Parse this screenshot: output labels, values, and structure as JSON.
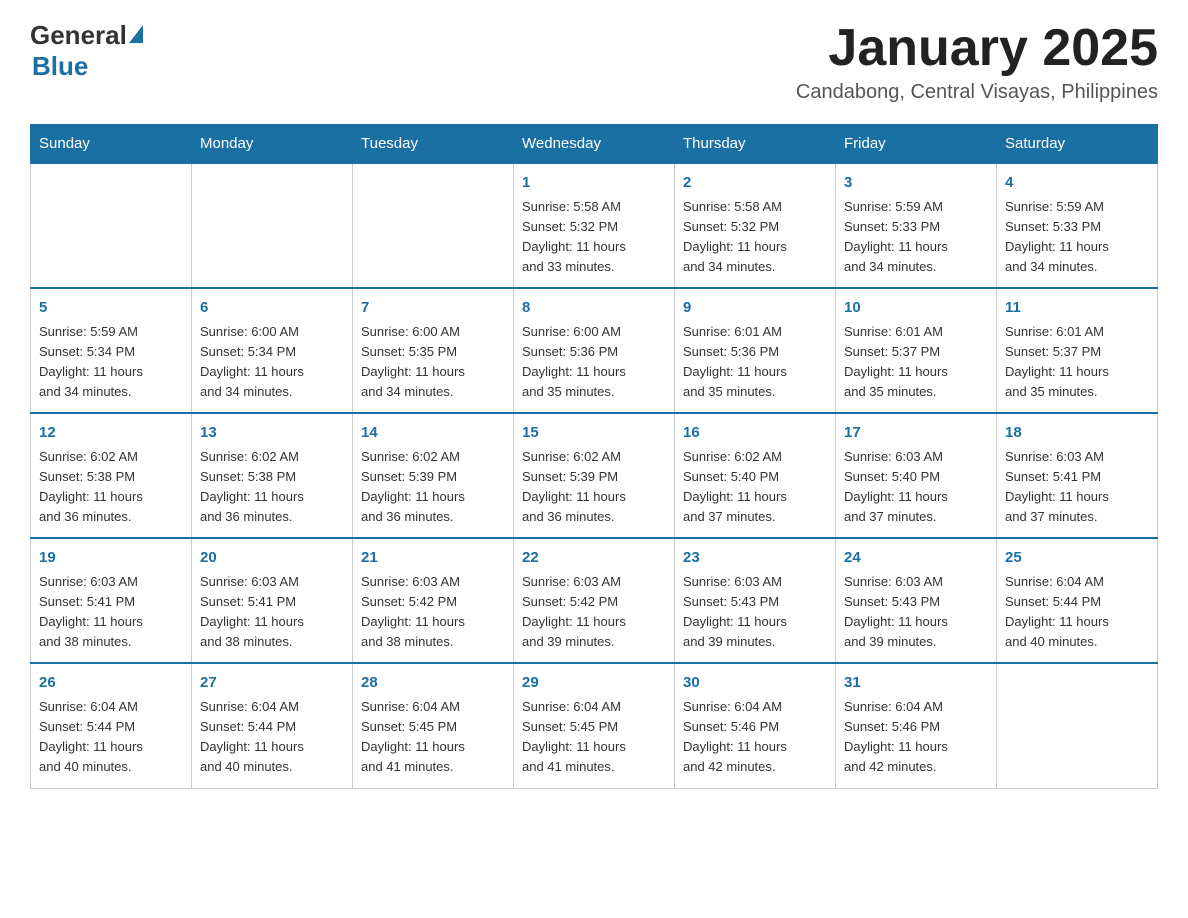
{
  "header": {
    "logo_general": "General",
    "logo_blue": "Blue",
    "month_title": "January 2025",
    "location": "Candabong, Central Visayas, Philippines"
  },
  "days_of_week": [
    "Sunday",
    "Monday",
    "Tuesday",
    "Wednesday",
    "Thursday",
    "Friday",
    "Saturday"
  ],
  "weeks": [
    [
      {
        "day": "",
        "info": ""
      },
      {
        "day": "",
        "info": ""
      },
      {
        "day": "",
        "info": ""
      },
      {
        "day": "1",
        "info": "Sunrise: 5:58 AM\nSunset: 5:32 PM\nDaylight: 11 hours\nand 33 minutes."
      },
      {
        "day": "2",
        "info": "Sunrise: 5:58 AM\nSunset: 5:32 PM\nDaylight: 11 hours\nand 34 minutes."
      },
      {
        "day": "3",
        "info": "Sunrise: 5:59 AM\nSunset: 5:33 PM\nDaylight: 11 hours\nand 34 minutes."
      },
      {
        "day": "4",
        "info": "Sunrise: 5:59 AM\nSunset: 5:33 PM\nDaylight: 11 hours\nand 34 minutes."
      }
    ],
    [
      {
        "day": "5",
        "info": "Sunrise: 5:59 AM\nSunset: 5:34 PM\nDaylight: 11 hours\nand 34 minutes."
      },
      {
        "day": "6",
        "info": "Sunrise: 6:00 AM\nSunset: 5:34 PM\nDaylight: 11 hours\nand 34 minutes."
      },
      {
        "day": "7",
        "info": "Sunrise: 6:00 AM\nSunset: 5:35 PM\nDaylight: 11 hours\nand 34 minutes."
      },
      {
        "day": "8",
        "info": "Sunrise: 6:00 AM\nSunset: 5:36 PM\nDaylight: 11 hours\nand 35 minutes."
      },
      {
        "day": "9",
        "info": "Sunrise: 6:01 AM\nSunset: 5:36 PM\nDaylight: 11 hours\nand 35 minutes."
      },
      {
        "day": "10",
        "info": "Sunrise: 6:01 AM\nSunset: 5:37 PM\nDaylight: 11 hours\nand 35 minutes."
      },
      {
        "day": "11",
        "info": "Sunrise: 6:01 AM\nSunset: 5:37 PM\nDaylight: 11 hours\nand 35 minutes."
      }
    ],
    [
      {
        "day": "12",
        "info": "Sunrise: 6:02 AM\nSunset: 5:38 PM\nDaylight: 11 hours\nand 36 minutes."
      },
      {
        "day": "13",
        "info": "Sunrise: 6:02 AM\nSunset: 5:38 PM\nDaylight: 11 hours\nand 36 minutes."
      },
      {
        "day": "14",
        "info": "Sunrise: 6:02 AM\nSunset: 5:39 PM\nDaylight: 11 hours\nand 36 minutes."
      },
      {
        "day": "15",
        "info": "Sunrise: 6:02 AM\nSunset: 5:39 PM\nDaylight: 11 hours\nand 36 minutes."
      },
      {
        "day": "16",
        "info": "Sunrise: 6:02 AM\nSunset: 5:40 PM\nDaylight: 11 hours\nand 37 minutes."
      },
      {
        "day": "17",
        "info": "Sunrise: 6:03 AM\nSunset: 5:40 PM\nDaylight: 11 hours\nand 37 minutes."
      },
      {
        "day": "18",
        "info": "Sunrise: 6:03 AM\nSunset: 5:41 PM\nDaylight: 11 hours\nand 37 minutes."
      }
    ],
    [
      {
        "day": "19",
        "info": "Sunrise: 6:03 AM\nSunset: 5:41 PM\nDaylight: 11 hours\nand 38 minutes."
      },
      {
        "day": "20",
        "info": "Sunrise: 6:03 AM\nSunset: 5:41 PM\nDaylight: 11 hours\nand 38 minutes."
      },
      {
        "day": "21",
        "info": "Sunrise: 6:03 AM\nSunset: 5:42 PM\nDaylight: 11 hours\nand 38 minutes."
      },
      {
        "day": "22",
        "info": "Sunrise: 6:03 AM\nSunset: 5:42 PM\nDaylight: 11 hours\nand 39 minutes."
      },
      {
        "day": "23",
        "info": "Sunrise: 6:03 AM\nSunset: 5:43 PM\nDaylight: 11 hours\nand 39 minutes."
      },
      {
        "day": "24",
        "info": "Sunrise: 6:03 AM\nSunset: 5:43 PM\nDaylight: 11 hours\nand 39 minutes."
      },
      {
        "day": "25",
        "info": "Sunrise: 6:04 AM\nSunset: 5:44 PM\nDaylight: 11 hours\nand 40 minutes."
      }
    ],
    [
      {
        "day": "26",
        "info": "Sunrise: 6:04 AM\nSunset: 5:44 PM\nDaylight: 11 hours\nand 40 minutes."
      },
      {
        "day": "27",
        "info": "Sunrise: 6:04 AM\nSunset: 5:44 PM\nDaylight: 11 hours\nand 40 minutes."
      },
      {
        "day": "28",
        "info": "Sunrise: 6:04 AM\nSunset: 5:45 PM\nDaylight: 11 hours\nand 41 minutes."
      },
      {
        "day": "29",
        "info": "Sunrise: 6:04 AM\nSunset: 5:45 PM\nDaylight: 11 hours\nand 41 minutes."
      },
      {
        "day": "30",
        "info": "Sunrise: 6:04 AM\nSunset: 5:46 PM\nDaylight: 11 hours\nand 42 minutes."
      },
      {
        "day": "31",
        "info": "Sunrise: 6:04 AM\nSunset: 5:46 PM\nDaylight: 11 hours\nand 42 minutes."
      },
      {
        "day": "",
        "info": ""
      }
    ]
  ]
}
